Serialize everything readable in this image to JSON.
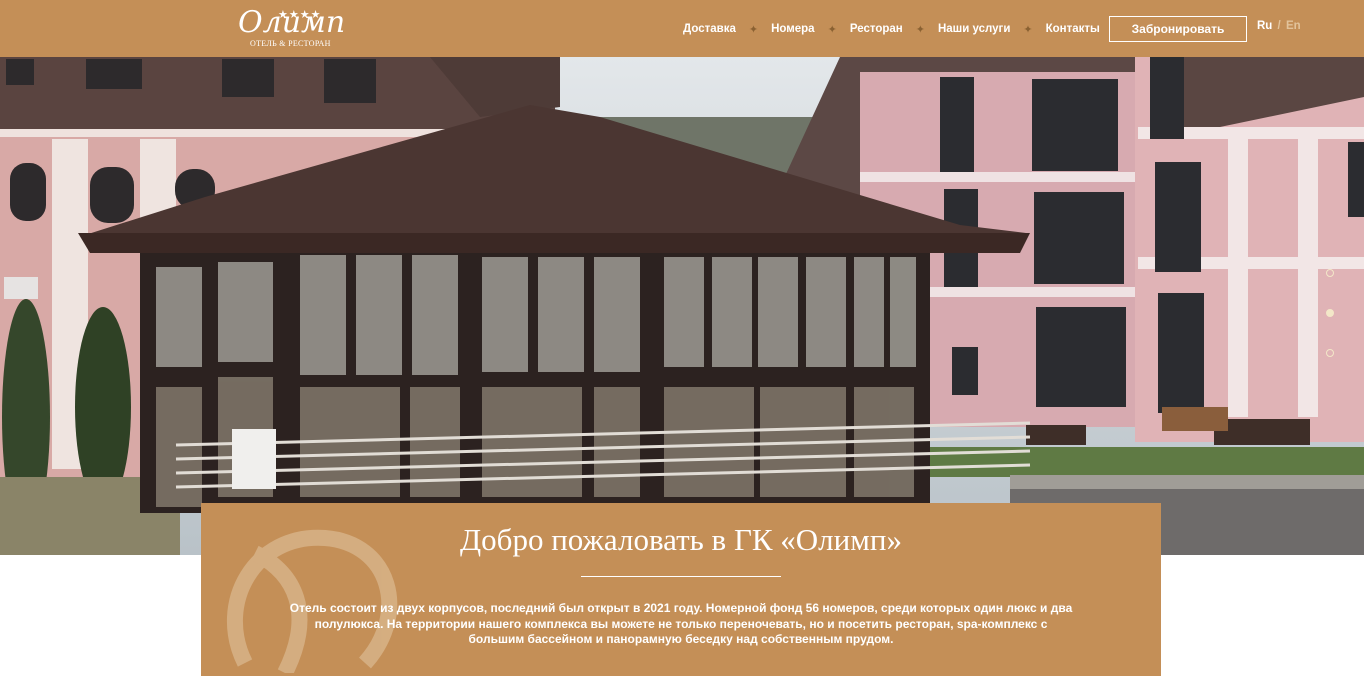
{
  "header": {
    "logo": {
      "script": "Олимп",
      "stars": "★★★★",
      "subtitle": "ОТЕЛЬ & РЕСТОРАН"
    },
    "nav": [
      {
        "label": "Доставка"
      },
      {
        "label": "Номера"
      },
      {
        "label": "Ресторан"
      },
      {
        "label": "Наши услуги"
      },
      {
        "label": "Контакты"
      }
    ],
    "nav_separator": "✦",
    "book_button": "Забронировать",
    "lang": {
      "ru": "Ru",
      "separator": "/",
      "en": "En"
    }
  },
  "hero": {
    "slides_count": 3,
    "active_slide": 2
  },
  "welcome": {
    "title": "Добро пожаловать в ГК «Олимп»",
    "text": "Отель состоит из двух корпусов, последний был открыт в 2021 году. Номерной фонд 56 номеров, среди которых один люкс и два полулюкса. На территории нашего комплекса вы можете не только переночевать, но и посетить ресторан, spa-комплекс с большим бассейном и панорамную беседку над собственным прудом."
  },
  "colors": {
    "brand": "#c48f57",
    "accent_dark": "#8a6132",
    "light": "#ffffff"
  }
}
